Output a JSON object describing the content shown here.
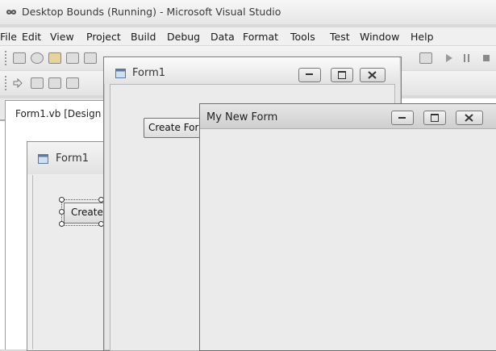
{
  "vs_window": {
    "title": "Desktop Bounds (Running) - Microsoft Visual Studio",
    "menu": [
      "File",
      "Edit",
      "View",
      "Project",
      "Build",
      "Debug",
      "Data",
      "Format",
      "Tools",
      "Test",
      "Window",
      "Help"
    ]
  },
  "document_tab": {
    "label": "Form1.vb [Design"
  },
  "design_form": {
    "title": "Form1",
    "button_label": "Create"
  },
  "running_form1": {
    "title": "Form1",
    "button_label": "Create For"
  },
  "my_new_form": {
    "title": "My New Form"
  },
  "icons": {
    "vs_logo": "infinity-icon",
    "form_icon": "form-window-icon",
    "minimize": "minimize-icon",
    "maximize": "maximize-icon",
    "close": "close-icon"
  }
}
